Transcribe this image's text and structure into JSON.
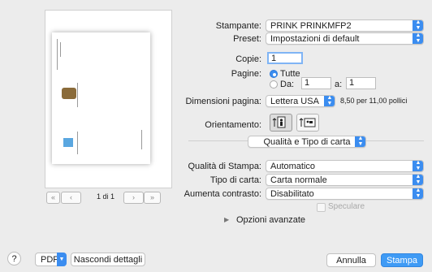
{
  "preview": {
    "page_indicator": "1 di 1",
    "nav_first": "«",
    "nav_prev": "‹",
    "nav_next": "›",
    "nav_last": "»"
  },
  "printer": {
    "label": "Stampante:",
    "value": "PRINK PRINKMFP2"
  },
  "preset": {
    "label": "Preset:",
    "value": "Impostazioni di default"
  },
  "copies": {
    "label": "Copie:",
    "value": "1"
  },
  "pages": {
    "label": "Pagine:",
    "all_label": "Tutte",
    "from_label": "Da:",
    "from_value": "1",
    "to_label": "a:",
    "to_value": "1",
    "selected": "all"
  },
  "paper_size": {
    "label": "Dimensioni pagina:",
    "value": "Lettera USA",
    "dimensions": "8,50 per 11,00 pollici"
  },
  "orientation": {
    "label": "Orientamento:",
    "selected": "portrait"
  },
  "section": {
    "value": "Qualità e Tipo di carta"
  },
  "print_quality": {
    "label": "Qualità di Stampa:",
    "value": "Automatico"
  },
  "paper_type": {
    "label": "Tipo di carta:",
    "value": "Carta normale"
  },
  "contrast": {
    "label": "Aumenta contrasto:",
    "value": "Disabilitato"
  },
  "mirror": {
    "label": "Speculare",
    "checked": false
  },
  "advanced": {
    "label": "Opzioni avanzate"
  },
  "footer": {
    "help": "?",
    "pdf": "PDF",
    "hide_details": "Nascondi dettagli",
    "cancel": "Annulla",
    "print": "Stampa"
  },
  "colors": {
    "accent": "#3b8df0",
    "primary_button": "#3f9bf5"
  }
}
